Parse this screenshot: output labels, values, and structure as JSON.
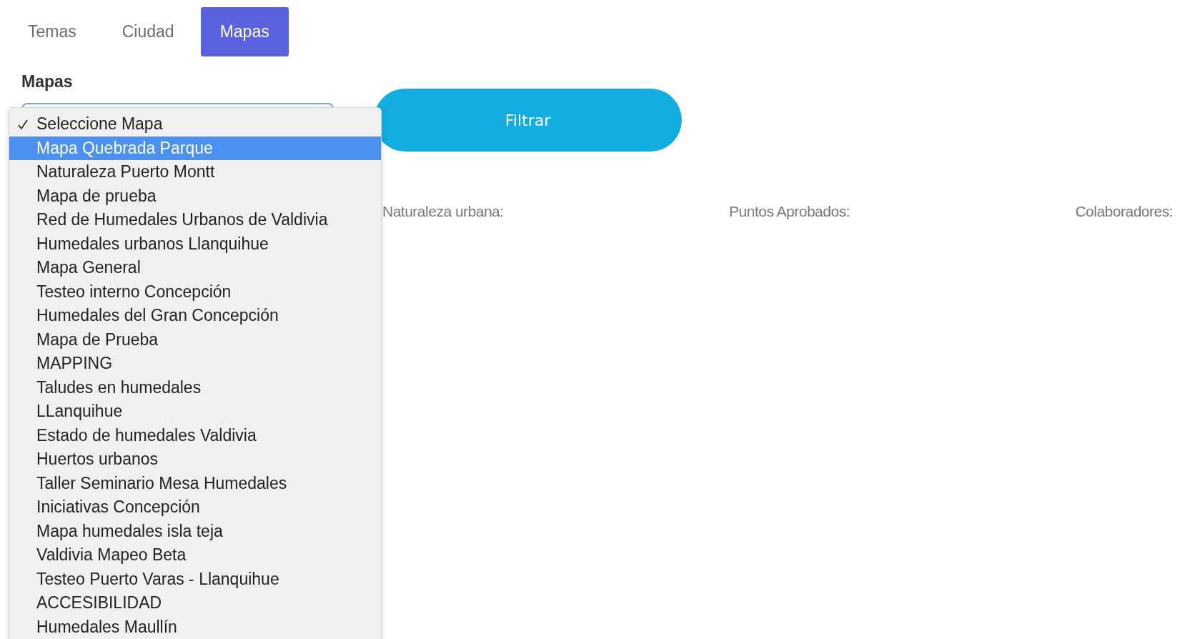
{
  "tabs": [
    {
      "label": "Temas",
      "selected": false
    },
    {
      "label": "Ciudad",
      "selected": false
    },
    {
      "label": "Mapas",
      "selected": true
    }
  ],
  "map_select": {
    "label": "Mapas",
    "options": [
      {
        "label": "Seleccione Mapa",
        "checked": true,
        "selected": false
      },
      {
        "label": "Mapa Quebrada Parque",
        "checked": false,
        "selected": true
      },
      {
        "label": "Naturaleza Puerto Montt",
        "checked": false,
        "selected": false
      },
      {
        "label": "Mapa de prueba",
        "checked": false,
        "selected": false
      },
      {
        "label": "Red de Humedales Urbanos de Valdivia",
        "checked": false,
        "selected": false
      },
      {
        "label": "Humedales urbanos Llanquihue",
        "checked": false,
        "selected": false
      },
      {
        "label": "Mapa General",
        "checked": false,
        "selected": false
      },
      {
        "label": "Testeo interno Concepción",
        "checked": false,
        "selected": false
      },
      {
        "label": "Humedales del Gran Concepción",
        "checked": false,
        "selected": false
      },
      {
        "label": "Mapa de Prueba",
        "checked": false,
        "selected": false
      },
      {
        "label": "MAPPING",
        "checked": false,
        "selected": false
      },
      {
        "label": "Taludes en humedales",
        "checked": false,
        "selected": false
      },
      {
        "label": "LLanquihue",
        "checked": false,
        "selected": false
      },
      {
        "label": "Estado de humedales Valdivia",
        "checked": false,
        "selected": false
      },
      {
        "label": "Huertos urbanos",
        "checked": false,
        "selected": false
      },
      {
        "label": "Taller Seminario Mesa Humedales",
        "checked": false,
        "selected": false
      },
      {
        "label": "Iniciativas Concepción",
        "checked": false,
        "selected": false
      },
      {
        "label": "Mapa humedales isla teja",
        "checked": false,
        "selected": false
      },
      {
        "label": "Valdivia Mapeo Beta",
        "checked": false,
        "selected": false
      },
      {
        "label": "Testeo Puerto Varas - Llanquihue",
        "checked": false,
        "selected": false
      },
      {
        "label": "ACCESIBILIDAD",
        "checked": false,
        "selected": false
      },
      {
        "label": "Humedales Maullín",
        "checked": false,
        "selected": false
      }
    ]
  },
  "filter_button": "Filtrar",
  "stats": [
    "Naturaleza urbana:",
    "Puntos Aprobados:",
    "Colaboradores:"
  ]
}
